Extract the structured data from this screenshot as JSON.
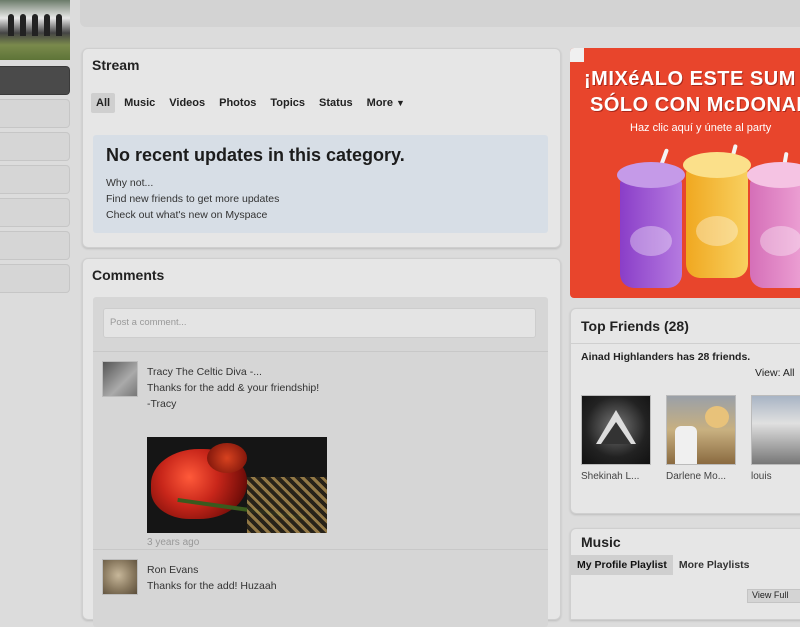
{
  "stream": {
    "title": "Stream",
    "tabs": [
      "All",
      "Music",
      "Videos",
      "Photos",
      "Topics",
      "Status",
      "More"
    ],
    "empty_title": "No recent updates in this category.",
    "empty_lines": [
      "Why not...",
      "Find new friends to get more updates",
      "Check out what's new on Myspace"
    ]
  },
  "comments": {
    "title": "Comments",
    "input_placeholder": "Post a comment...",
    "items": [
      {
        "author": "Tracy The Celtic Diva -...",
        "lines": [
          "Thanks for the add & your friendship!",
          "-Tracy"
        ],
        "time": "3 years ago"
      },
      {
        "author": "Ron Evans",
        "lines": [
          "Thanks for the add! Huzaah"
        ]
      }
    ]
  },
  "ad": {
    "line1": "¡MIXéALO ESTE SUM",
    "line2": "SÓLO CON McDONAL",
    "line3": "Haz clic aquí y únete al party",
    "colors": {
      "background": "#e8452c"
    }
  },
  "top_friends": {
    "title": "Top Friends (28)",
    "count_text": "Ainad Highlanders has 28 friends.",
    "view_text": "View:  All",
    "friends": [
      {
        "name": "Shekinah L..."
      },
      {
        "name": "Darlene Mo..."
      },
      {
        "name": "louis"
      }
    ]
  },
  "music": {
    "title": "Music",
    "tabs": [
      "My Profile Playlist",
      "More Playlists"
    ],
    "view_full": "View Full"
  }
}
